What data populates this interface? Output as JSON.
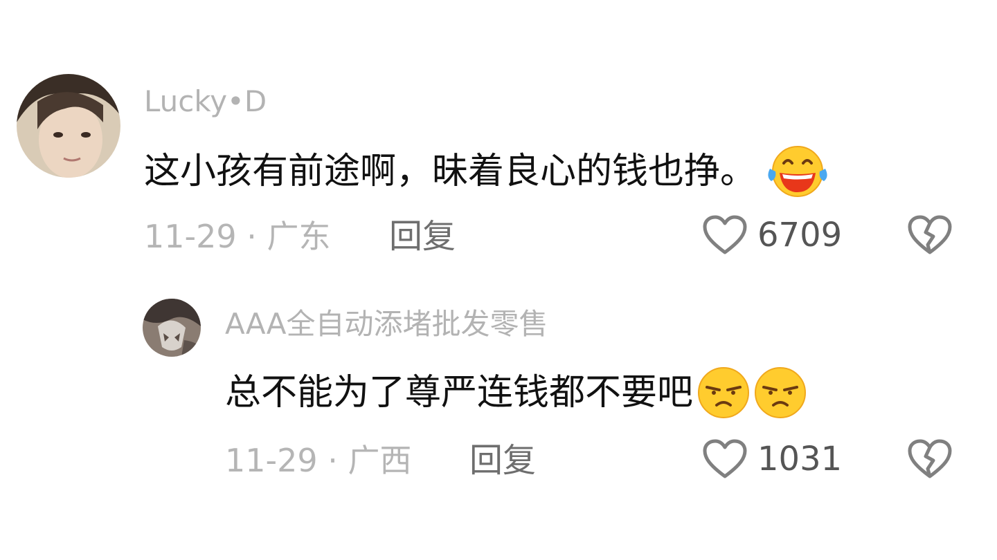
{
  "comments": [
    {
      "username": "Lucky•D",
      "text": "这小孩有前途啊，昧着良心的钱也挣。",
      "emojis": [
        "laughing-tears-emoji"
      ],
      "meta": "11-29 · 广东",
      "reply_label": "回复",
      "like_count": "6709"
    },
    {
      "username": "AAA全自动添堵批发零售",
      "text": "总不能为了尊严连钱都不要吧",
      "emojis": [
        "frowning-emoji",
        "frowning-emoji"
      ],
      "meta": "11-29 · 广西",
      "reply_label": "回复",
      "like_count": "1031"
    }
  ],
  "icons": {
    "like": "heart-outline-icon",
    "dislike": "broken-heart-icon"
  },
  "colors": {
    "username": "#b3b3b3",
    "text": "#111111",
    "meta": "#b5b5b5",
    "reply": "#6e6e6e",
    "icon": "#808080"
  }
}
